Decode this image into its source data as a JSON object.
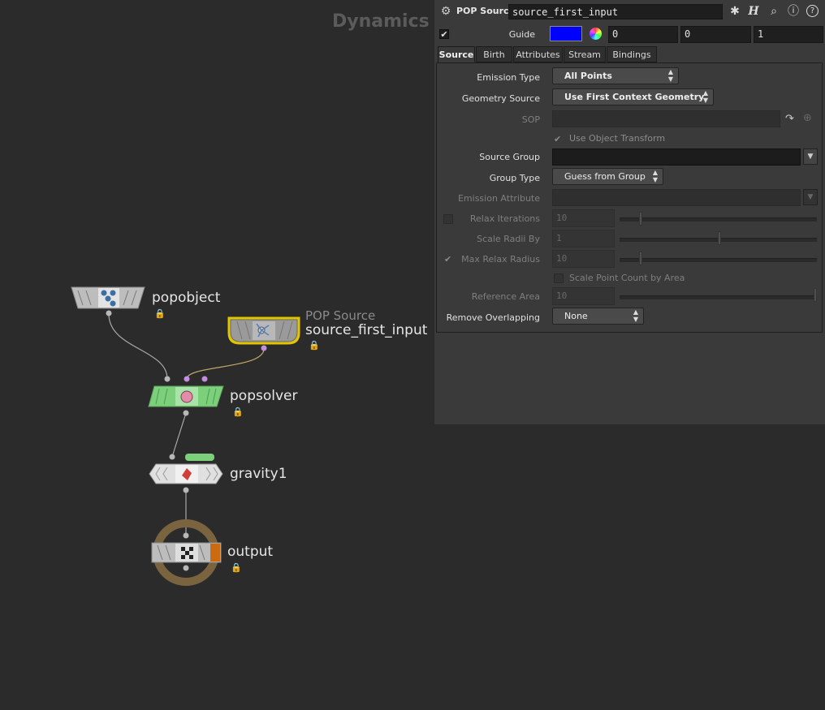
{
  "network": {
    "context_label": "Dynamics",
    "nodes": {
      "popobject": {
        "name": "popobject"
      },
      "source": {
        "type_label": "POP Source",
        "name": "source_first_input"
      },
      "popsolver": {
        "name": "popsolver"
      },
      "gravity": {
        "name": "gravity1"
      },
      "output": {
        "name": "output"
      }
    }
  },
  "params": {
    "header": {
      "op_type": "POP Source",
      "node_name": "source_first_input",
      "help_label": "?"
    },
    "guide": {
      "label": "Guide",
      "color": "#0000ff",
      "values": [
        "0",
        "0",
        "1"
      ]
    },
    "tabs": [
      "Source",
      "Birth",
      "Attributes",
      "Stream",
      "Bindings"
    ],
    "active_tab": "Source",
    "fields": {
      "emission_type": {
        "label": "Emission Type",
        "value": "All Points"
      },
      "geometry_source": {
        "label": "Geometry Source",
        "value": "Use First Context Geometry"
      },
      "sop": {
        "label": "SOP",
        "value": ""
      },
      "use_object_transform": {
        "label": "Use Object Transform",
        "checked": true
      },
      "source_group": {
        "label": "Source Group",
        "value": ""
      },
      "group_type": {
        "label": "Group Type",
        "value": "Guess from Group"
      },
      "emission_attribute": {
        "label": "Emission Attribute",
        "value": ""
      },
      "relax_iterations": {
        "label": "Relax Iterations",
        "value": "10",
        "checked": false
      },
      "scale_radii_by": {
        "label": "Scale Radii By",
        "value": "1"
      },
      "max_relax_radius": {
        "label": "Max Relax Radius",
        "value": "10",
        "checked": true
      },
      "scale_point_count": {
        "label": "Scale Point Count by Area",
        "checked": false
      },
      "reference_area": {
        "label": "Reference Area",
        "value": "10"
      },
      "remove_overlapping": {
        "label": "Remove Overlapping",
        "value": "None"
      }
    }
  }
}
